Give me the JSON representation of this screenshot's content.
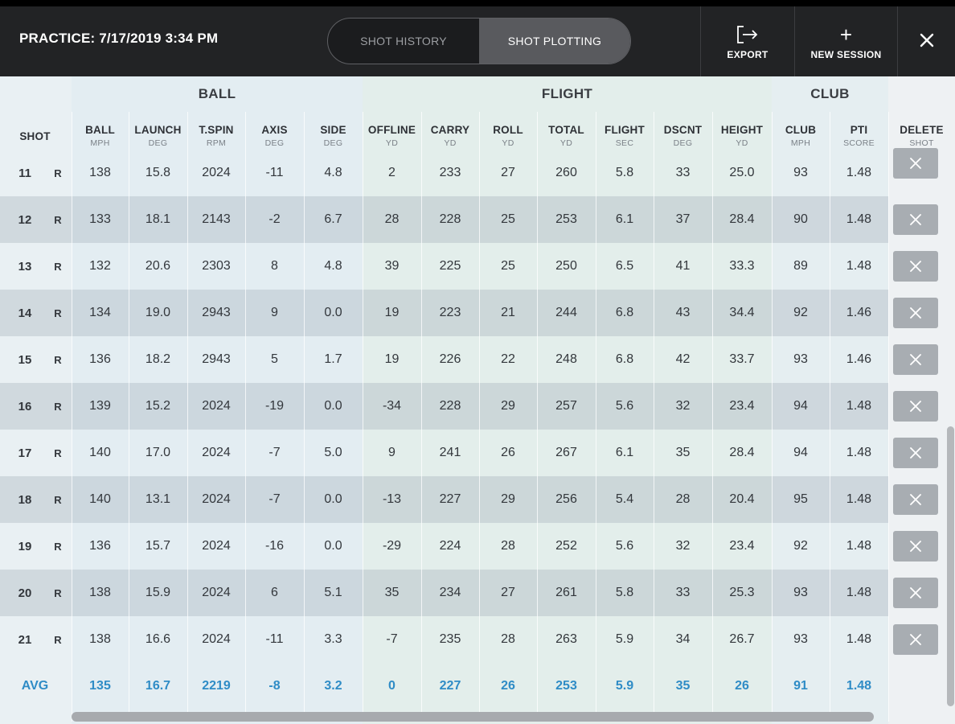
{
  "header": {
    "session_title": "PRACTICE: 7/17/2019 3:34 PM",
    "tabs": [
      {
        "label": "SHOT HISTORY",
        "active": false
      },
      {
        "label": "SHOT PLOTTING",
        "active": true
      }
    ],
    "export_label": "EXPORT",
    "new_session_label": "NEW SESSION",
    "icons": {
      "export": "export-arrow-icon",
      "new_session": "plus-icon",
      "close": "close-icon"
    }
  },
  "table": {
    "groups": {
      "ball": "BALL",
      "flight": "FLIGHT",
      "club": "CLUB"
    },
    "shot_header": "SHOT",
    "delete_header": {
      "title": "DELETE",
      "sub": "SHOT"
    },
    "columns": [
      {
        "title": "BALL",
        "unit": "MPH"
      },
      {
        "title": "LAUNCH",
        "unit": "DEG"
      },
      {
        "title": "T.SPIN",
        "unit": "RPM"
      },
      {
        "title": "AXIS",
        "unit": "DEG"
      },
      {
        "title": "SIDE",
        "unit": "DEG"
      },
      {
        "title": "OFFLINE",
        "unit": "YD"
      },
      {
        "title": "CARRY",
        "unit": "YD"
      },
      {
        "title": "ROLL",
        "unit": "YD"
      },
      {
        "title": "TOTAL",
        "unit": "YD"
      },
      {
        "title": "FLIGHT",
        "unit": "SEC"
      },
      {
        "title": "DSCNT",
        "unit": "DEG"
      },
      {
        "title": "HEIGHT",
        "unit": "YD"
      },
      {
        "title": "CLUB",
        "unit": "MPH"
      },
      {
        "title": "PTI",
        "unit": "SCORE"
      }
    ],
    "rows": [
      {
        "shot": "11",
        "hand": "R",
        "values": [
          "138",
          "15.8",
          "2024",
          "-11",
          "4.8",
          "2",
          "233",
          "27",
          "260",
          "5.8",
          "33",
          "25.0",
          "93",
          "1.48"
        ]
      },
      {
        "shot": "12",
        "hand": "R",
        "values": [
          "133",
          "18.1",
          "2143",
          "-2",
          "6.7",
          "28",
          "228",
          "25",
          "253",
          "6.1",
          "37",
          "28.4",
          "90",
          "1.48"
        ]
      },
      {
        "shot": "13",
        "hand": "R",
        "values": [
          "132",
          "20.6",
          "2303",
          "8",
          "4.8",
          "39",
          "225",
          "25",
          "250",
          "6.5",
          "41",
          "33.3",
          "89",
          "1.48"
        ]
      },
      {
        "shot": "14",
        "hand": "R",
        "values": [
          "134",
          "19.0",
          "2943",
          "9",
          "0.0",
          "19",
          "223",
          "21",
          "244",
          "6.8",
          "43",
          "34.4",
          "92",
          "1.46"
        ]
      },
      {
        "shot": "15",
        "hand": "R",
        "values": [
          "136",
          "18.2",
          "2943",
          "5",
          "1.7",
          "19",
          "226",
          "22",
          "248",
          "6.8",
          "42",
          "33.7",
          "93",
          "1.46"
        ]
      },
      {
        "shot": "16",
        "hand": "R",
        "values": [
          "139",
          "15.2",
          "2024",
          "-19",
          "0.0",
          "-34",
          "228",
          "29",
          "257",
          "5.6",
          "32",
          "23.4",
          "94",
          "1.48"
        ]
      },
      {
        "shot": "17",
        "hand": "R",
        "values": [
          "140",
          "17.0",
          "2024",
          "-7",
          "5.0",
          "9",
          "241",
          "26",
          "267",
          "6.1",
          "35",
          "28.4",
          "94",
          "1.48"
        ]
      },
      {
        "shot": "18",
        "hand": "R",
        "values": [
          "140",
          "13.1",
          "2024",
          "-7",
          "0.0",
          "-13",
          "227",
          "29",
          "256",
          "5.4",
          "28",
          "20.4",
          "95",
          "1.48"
        ]
      },
      {
        "shot": "19",
        "hand": "R",
        "values": [
          "136",
          "15.7",
          "2024",
          "-16",
          "0.0",
          "-29",
          "224",
          "28",
          "252",
          "5.6",
          "32",
          "23.4",
          "92",
          "1.48"
        ]
      },
      {
        "shot": "20",
        "hand": "R",
        "values": [
          "138",
          "15.9",
          "2024",
          "6",
          "5.1",
          "35",
          "234",
          "27",
          "261",
          "5.8",
          "33",
          "25.3",
          "93",
          "1.48"
        ]
      },
      {
        "shot": "21",
        "hand": "R",
        "values": [
          "138",
          "16.6",
          "2024",
          "-11",
          "3.3",
          "-7",
          "235",
          "28",
          "263",
          "5.9",
          "34",
          "26.7",
          "93",
          "1.48"
        ]
      }
    ],
    "average": {
      "label": "AVG",
      "values": [
        "135",
        "16.7",
        "2219",
        "-8",
        "3.2",
        "0",
        "227",
        "26",
        "253",
        "5.9",
        "35",
        "26",
        "91",
        "1.48"
      ]
    },
    "delete_icon": "close-icon"
  },
  "colors": {
    "header_bg": "#222325",
    "avg_text": "#2f8cc6",
    "delete_button": "#a8adb2"
  }
}
